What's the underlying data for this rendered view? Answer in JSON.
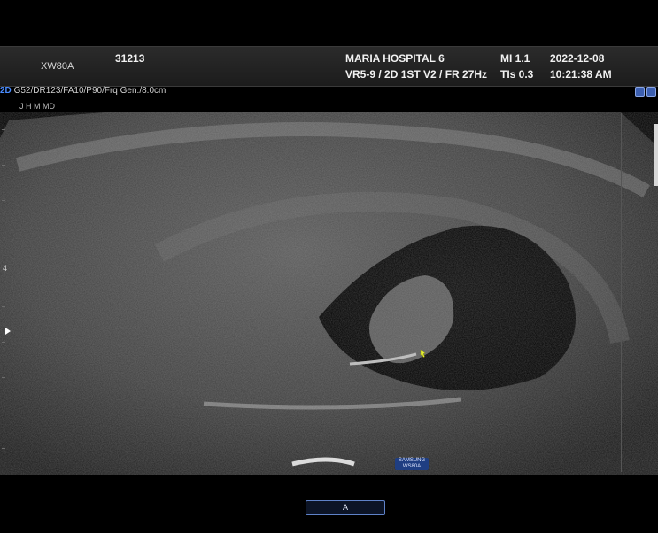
{
  "header": {
    "patient_id": "31213",
    "probe": "XW80A",
    "hospital": "MARIA HOSPITAL 6",
    "preset": "VR5-9 / 2D 1ST V2 / FR 27Hz",
    "mi": "MI  1.1",
    "tis": "TIs 0.3",
    "date": "2022-12-08",
    "time": "10:21:38 AM"
  },
  "params": {
    "mode": "2D",
    "settings": "G52/DR123/FA10/P90/Frq Gen./8.0cm",
    "operator": "J H M MD"
  },
  "depth_scale": {
    "label": "4"
  },
  "brand": {
    "line1": "SAMSUNG",
    "line2": "WS80A"
  },
  "bottom": {
    "button_label": "A"
  },
  "icons": {
    "focus": "triangle-right-icon",
    "cursor": "hand-pointer-icon",
    "view": "view-mode-icon",
    "zoom": "zoom-icon"
  }
}
